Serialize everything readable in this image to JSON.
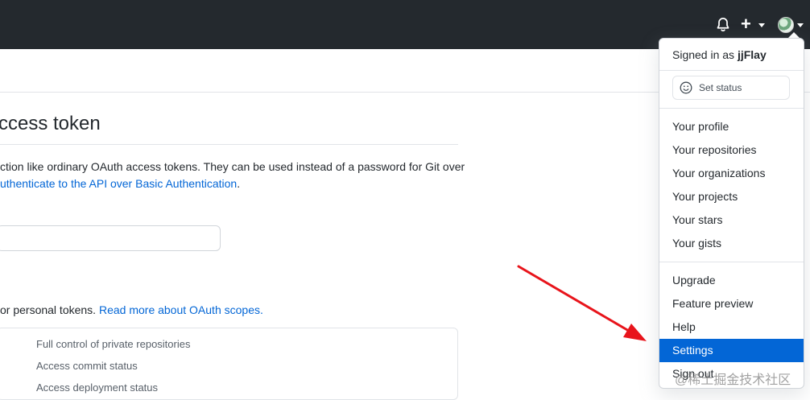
{
  "header": {
    "notifications_icon": "bell-icon",
    "create_icon": "plus-icon",
    "avatar_icon": "avatar"
  },
  "main": {
    "title": "ccess token",
    "description_line1": "ction like ordinary OAuth access tokens. They can be used instead of a password for Git over",
    "description_link": "uthenticate to the API over Basic Authentication",
    "description_end": ".",
    "scopes_text": "or personal tokens. ",
    "scopes_link": "Read more about OAuth scopes.",
    "scopes": [
      "Full control of private repositories",
      "Access commit status",
      "Access deployment status"
    ]
  },
  "menu": {
    "signed_in_prefix": "Signed in as ",
    "username": "jjFlay",
    "set_status_label": "Set status",
    "section1": [
      "Your profile",
      "Your repositories",
      "Your organizations",
      "Your projects",
      "Your stars",
      "Your gists"
    ],
    "section2": [
      "Upgrade",
      "Feature preview",
      "Help",
      "Settings",
      "Sign out"
    ],
    "active_item": "Settings"
  },
  "watermark": "@稀土掘金技术社区",
  "colors": {
    "header_bg": "#24292e",
    "link": "#0366d6",
    "active_bg": "#0366d6",
    "arrow": "#e8141b"
  }
}
